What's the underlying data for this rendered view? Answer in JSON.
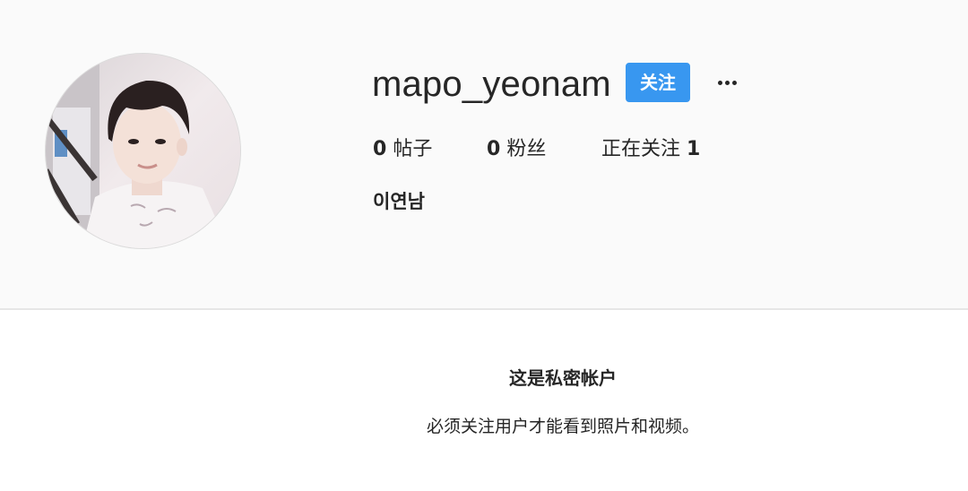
{
  "profile": {
    "username": "mapo_yeonam",
    "follow_label": "关注",
    "more_label": "...",
    "posts_count": "0",
    "posts_label": "帖子",
    "followers_count": "0",
    "followers_label": "粉丝",
    "following_label": "正在关注",
    "following_count": "1",
    "full_name": "이연남"
  },
  "private_notice": {
    "title": "这是私密帐户",
    "description": "必须关注用户才能看到照片和视频。"
  },
  "colors": {
    "accent": "#3897f0",
    "header_bg": "#fafafa",
    "text": "#262626",
    "divider": "#e6e6e6"
  },
  "icons": {
    "more": "more-dots-icon"
  }
}
